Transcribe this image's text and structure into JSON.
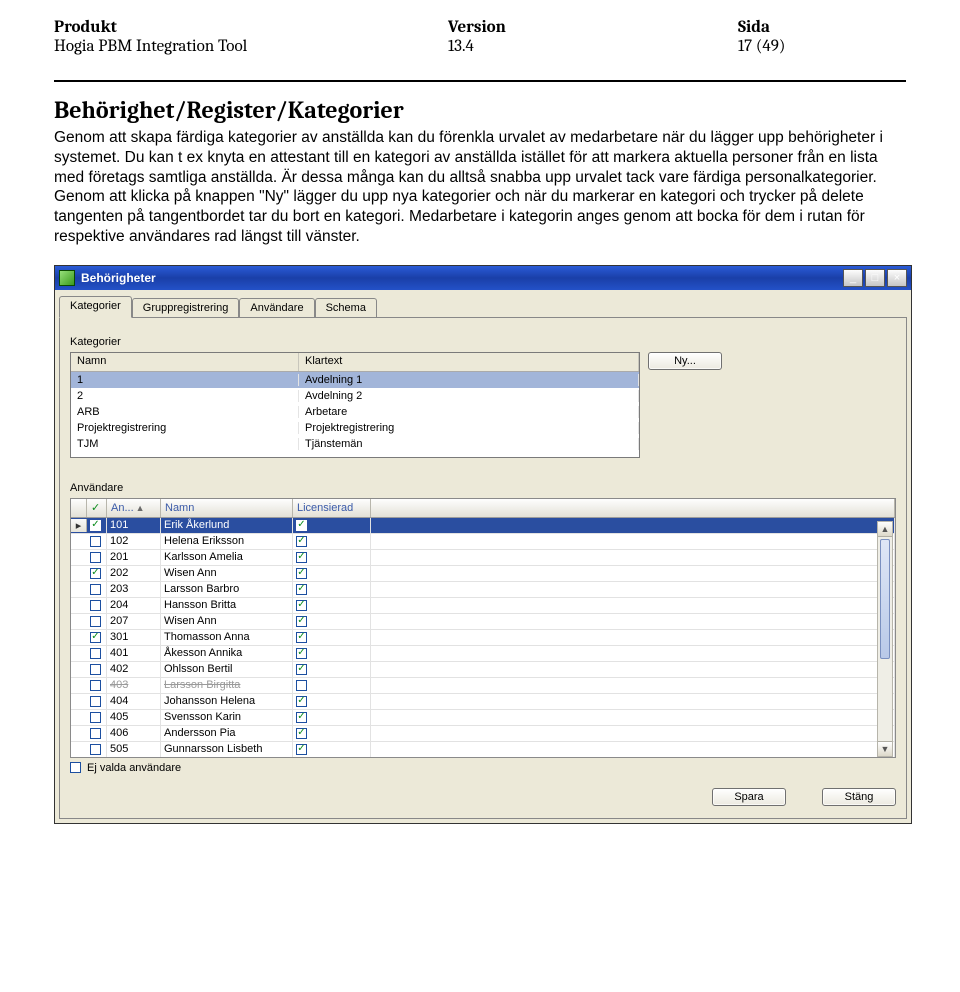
{
  "doc": {
    "headers": {
      "product": "Produkt",
      "version": "Version",
      "page": "Sida"
    },
    "product": "Hogia PBM Integration Tool",
    "version": "13.4",
    "page": "17 (49)",
    "section_title": "Behörighet/Register/Kategorier",
    "body": "Genom att skapa färdiga kategorier av anställda kan du förenkla urvalet av medarbetare när du lägger upp behörigheter i systemet. Du kan t ex knyta en attestant till en kategori av anställda istället för att markera aktuella personer från en lista med företags samtliga anställda. Är dessa många kan du alltså snabba upp urvalet tack vare färdiga personalkategorier. Genom att klicka på knappen \"Ny\" lägger du upp nya kategorier och när du markerar en kategori och trycker på delete tangenten på tangentbordet tar du bort en kategori. Medarbetare i kategorin anges genom att bocka för dem i rutan för respektive användares rad längst till vänster."
  },
  "window": {
    "title": "Behörigheter",
    "tabs": [
      "Kategorier",
      "Gruppregistrering",
      "Användare",
      "Schema"
    ],
    "active_tab": 0,
    "kat_label": "Kategorier",
    "kat_columns": {
      "name": "Namn",
      "klartext": "Klartext"
    },
    "kategorier": [
      {
        "namn": "1",
        "klartext": "Avdelning 1",
        "selected": true
      },
      {
        "namn": "2",
        "klartext": "Avdelning 2"
      },
      {
        "namn": "ARB",
        "klartext": "Arbetare"
      },
      {
        "namn": "Projektregistrering",
        "klartext": "Projektregistrering"
      },
      {
        "namn": "TJM",
        "klartext": "Tjänstemän"
      }
    ],
    "ny_button": "Ny...",
    "anv_label": "Användare",
    "anv_columns": {
      "chk_header": "✓",
      "an": "An...",
      "namn": "Namn",
      "lic": "Licensierad"
    },
    "anvandare": [
      {
        "chk": true,
        "an": "101",
        "namn": "Erik Åkerlund",
        "lic": true,
        "selected": true
      },
      {
        "chk": false,
        "an": "102",
        "namn": "Helena Eriksson",
        "lic": true
      },
      {
        "chk": false,
        "an": "201",
        "namn": "Karlsson Amelia",
        "lic": true
      },
      {
        "chk": true,
        "an": "202",
        "namn": "Wisen Ann",
        "lic": true
      },
      {
        "chk": false,
        "an": "203",
        "namn": "Larsson Barbro",
        "lic": true
      },
      {
        "chk": false,
        "an": "204",
        "namn": "Hansson Britta",
        "lic": true
      },
      {
        "chk": false,
        "an": "207",
        "namn": "Wisen Ann",
        "lic": true
      },
      {
        "chk": true,
        "an": "301",
        "namn": "Thomasson Anna",
        "lic": true
      },
      {
        "chk": false,
        "an": "401",
        "namn": "Åkesson Annika",
        "lic": true
      },
      {
        "chk": false,
        "an": "402",
        "namn": "Ohlsson Bertil",
        "lic": true
      },
      {
        "chk": false,
        "an": "403",
        "namn": "Larsson Birgitta",
        "lic": false,
        "disabled": true
      },
      {
        "chk": false,
        "an": "404",
        "namn": "Johansson Helena",
        "lic": true
      },
      {
        "chk": false,
        "an": "405",
        "namn": "Svensson Karin",
        "lic": true
      },
      {
        "chk": false,
        "an": "406",
        "namn": "Andersson Pia",
        "lic": true
      },
      {
        "chk": false,
        "an": "505",
        "namn": "Gunnarsson Lisbeth",
        "lic": true
      }
    ],
    "ej_valda_label": "Ej valda användare",
    "ej_valda_checked": false,
    "save_button": "Spara",
    "close_button": "Stäng"
  }
}
